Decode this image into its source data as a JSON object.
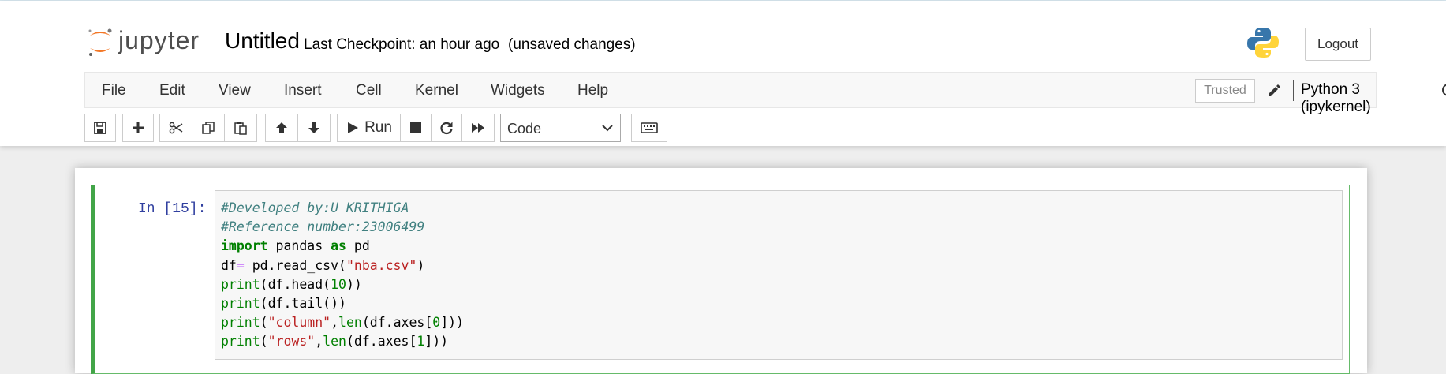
{
  "header": {
    "logo_text": "jupyter",
    "notebook_title": "Untitled",
    "checkpoint": "Last Checkpoint: an hour ago",
    "save_status": "(unsaved changes)",
    "logout_label": "Logout"
  },
  "menubar": {
    "items": [
      "File",
      "Edit",
      "View",
      "Insert",
      "Cell",
      "Kernel",
      "Widgets",
      "Help"
    ],
    "trusted_label": "Trusted",
    "kernel_name": "Python 3 (ipykernel)"
  },
  "toolbar": {
    "run_label": "Run",
    "cell_type": "Code",
    "icons": [
      "save-icon",
      "plus-icon",
      "cut-icon",
      "copy-icon",
      "paste-icon",
      "arrow-up-icon",
      "arrow-down-icon",
      "play-icon",
      "stop-icon",
      "restart-icon",
      "fast-forward-icon",
      "keyboard-icon"
    ]
  },
  "cell": {
    "prompt": "In [15]:",
    "lines": {
      "l1": "#Developed by:U KRITHIGA",
      "l2": "#Reference number:23006499",
      "l3_kw1": "import",
      "l3_mod": "pandas",
      "l3_kw2": "as",
      "l3_alias": "pd",
      "l4_a": "df",
      "l4_op": "=",
      "l4_b": " pd.read_csv(",
      "l4_str": "\"nba.csv\"",
      "l4_c": ")",
      "l5_fn": "print",
      "l5_a": "(df.head(",
      "l5_num": "10",
      "l5_b": "))",
      "l6_fn": "print",
      "l6_a": "(df.tail())",
      "l7_fn": "print",
      "l7_a": "(",
      "l7_str": "\"column\"",
      "l7_b": ",",
      "l7_fn2": "len",
      "l7_c": "(df.axes[",
      "l7_num": "0",
      "l7_d": "]))",
      "l8_fn": "print",
      "l8_a": "(",
      "l8_str": "\"rows\"",
      "l8_b": ",",
      "l8_fn2": "len",
      "l8_c": "(df.axes[",
      "l8_num": "1",
      "l8_d": "]))"
    }
  },
  "colors": {
    "selected_cell_border": "#42a548",
    "prompt_color": "#303f9f",
    "comment_color": "#408080",
    "keyword_color": "#008000",
    "string_color": "#ba2121"
  }
}
